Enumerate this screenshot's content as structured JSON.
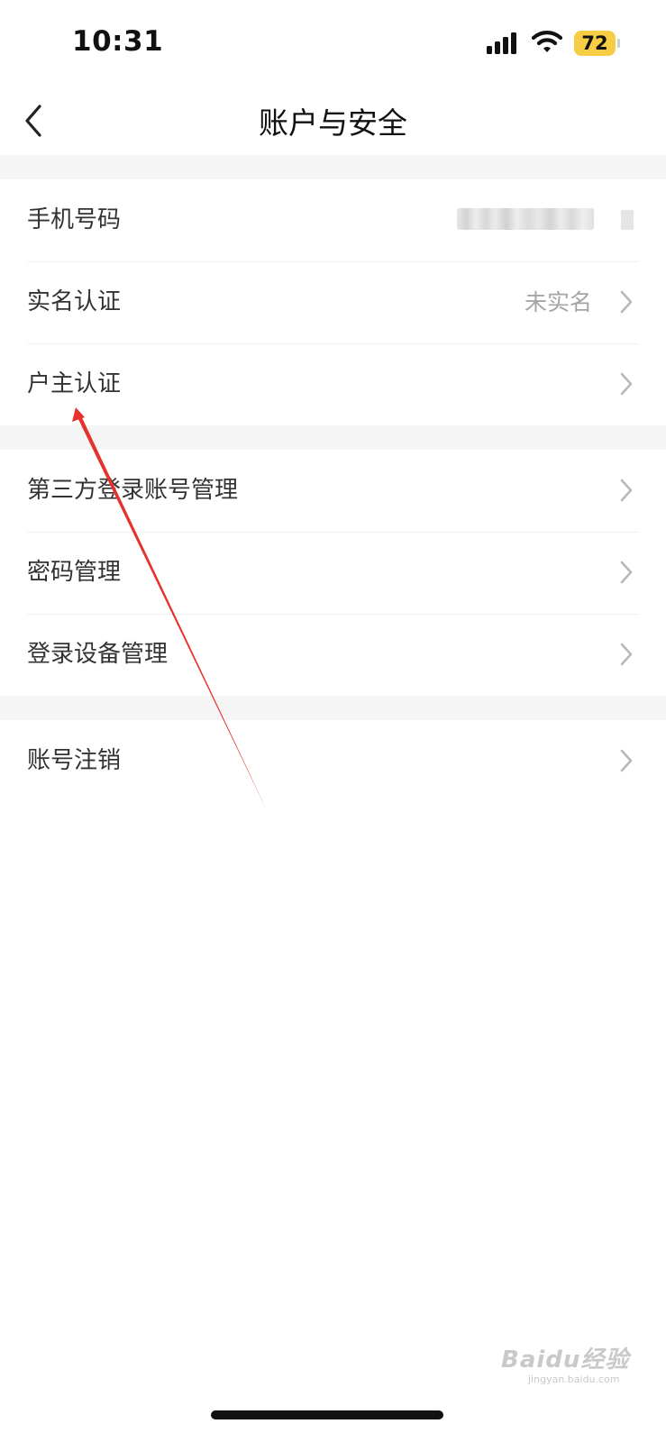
{
  "status_bar": {
    "time": "10:31",
    "battery": "72",
    "battery_color": "#f6cd44"
  },
  "nav": {
    "title": "账户与安全",
    "back_icon": "chevron-left-icon"
  },
  "groups": [
    {
      "items": [
        {
          "label": "手机号码",
          "value": "",
          "value_obscured": true
        },
        {
          "label": "实名认证",
          "value": "未实名"
        },
        {
          "label": "户主认证",
          "value": ""
        }
      ]
    },
    {
      "items": [
        {
          "label": "第三方登录账号管理",
          "value": ""
        },
        {
          "label": "密码管理",
          "value": ""
        },
        {
          "label": "登录设备管理",
          "value": ""
        }
      ]
    },
    {
      "items": [
        {
          "label": "账号注销",
          "value": ""
        }
      ]
    }
  ],
  "annotation": {
    "type": "arrow",
    "color": "#e5322d",
    "target": "户主认证"
  },
  "watermark": {
    "text": "Baidu经验",
    "sub": "jingyan.baidu.com"
  },
  "colors": {
    "background": "#ffffff",
    "section_gap": "#f5f5f5",
    "label": "#333333",
    "secondary": "#a5a5a5",
    "chevron": "#b8b8b8"
  }
}
